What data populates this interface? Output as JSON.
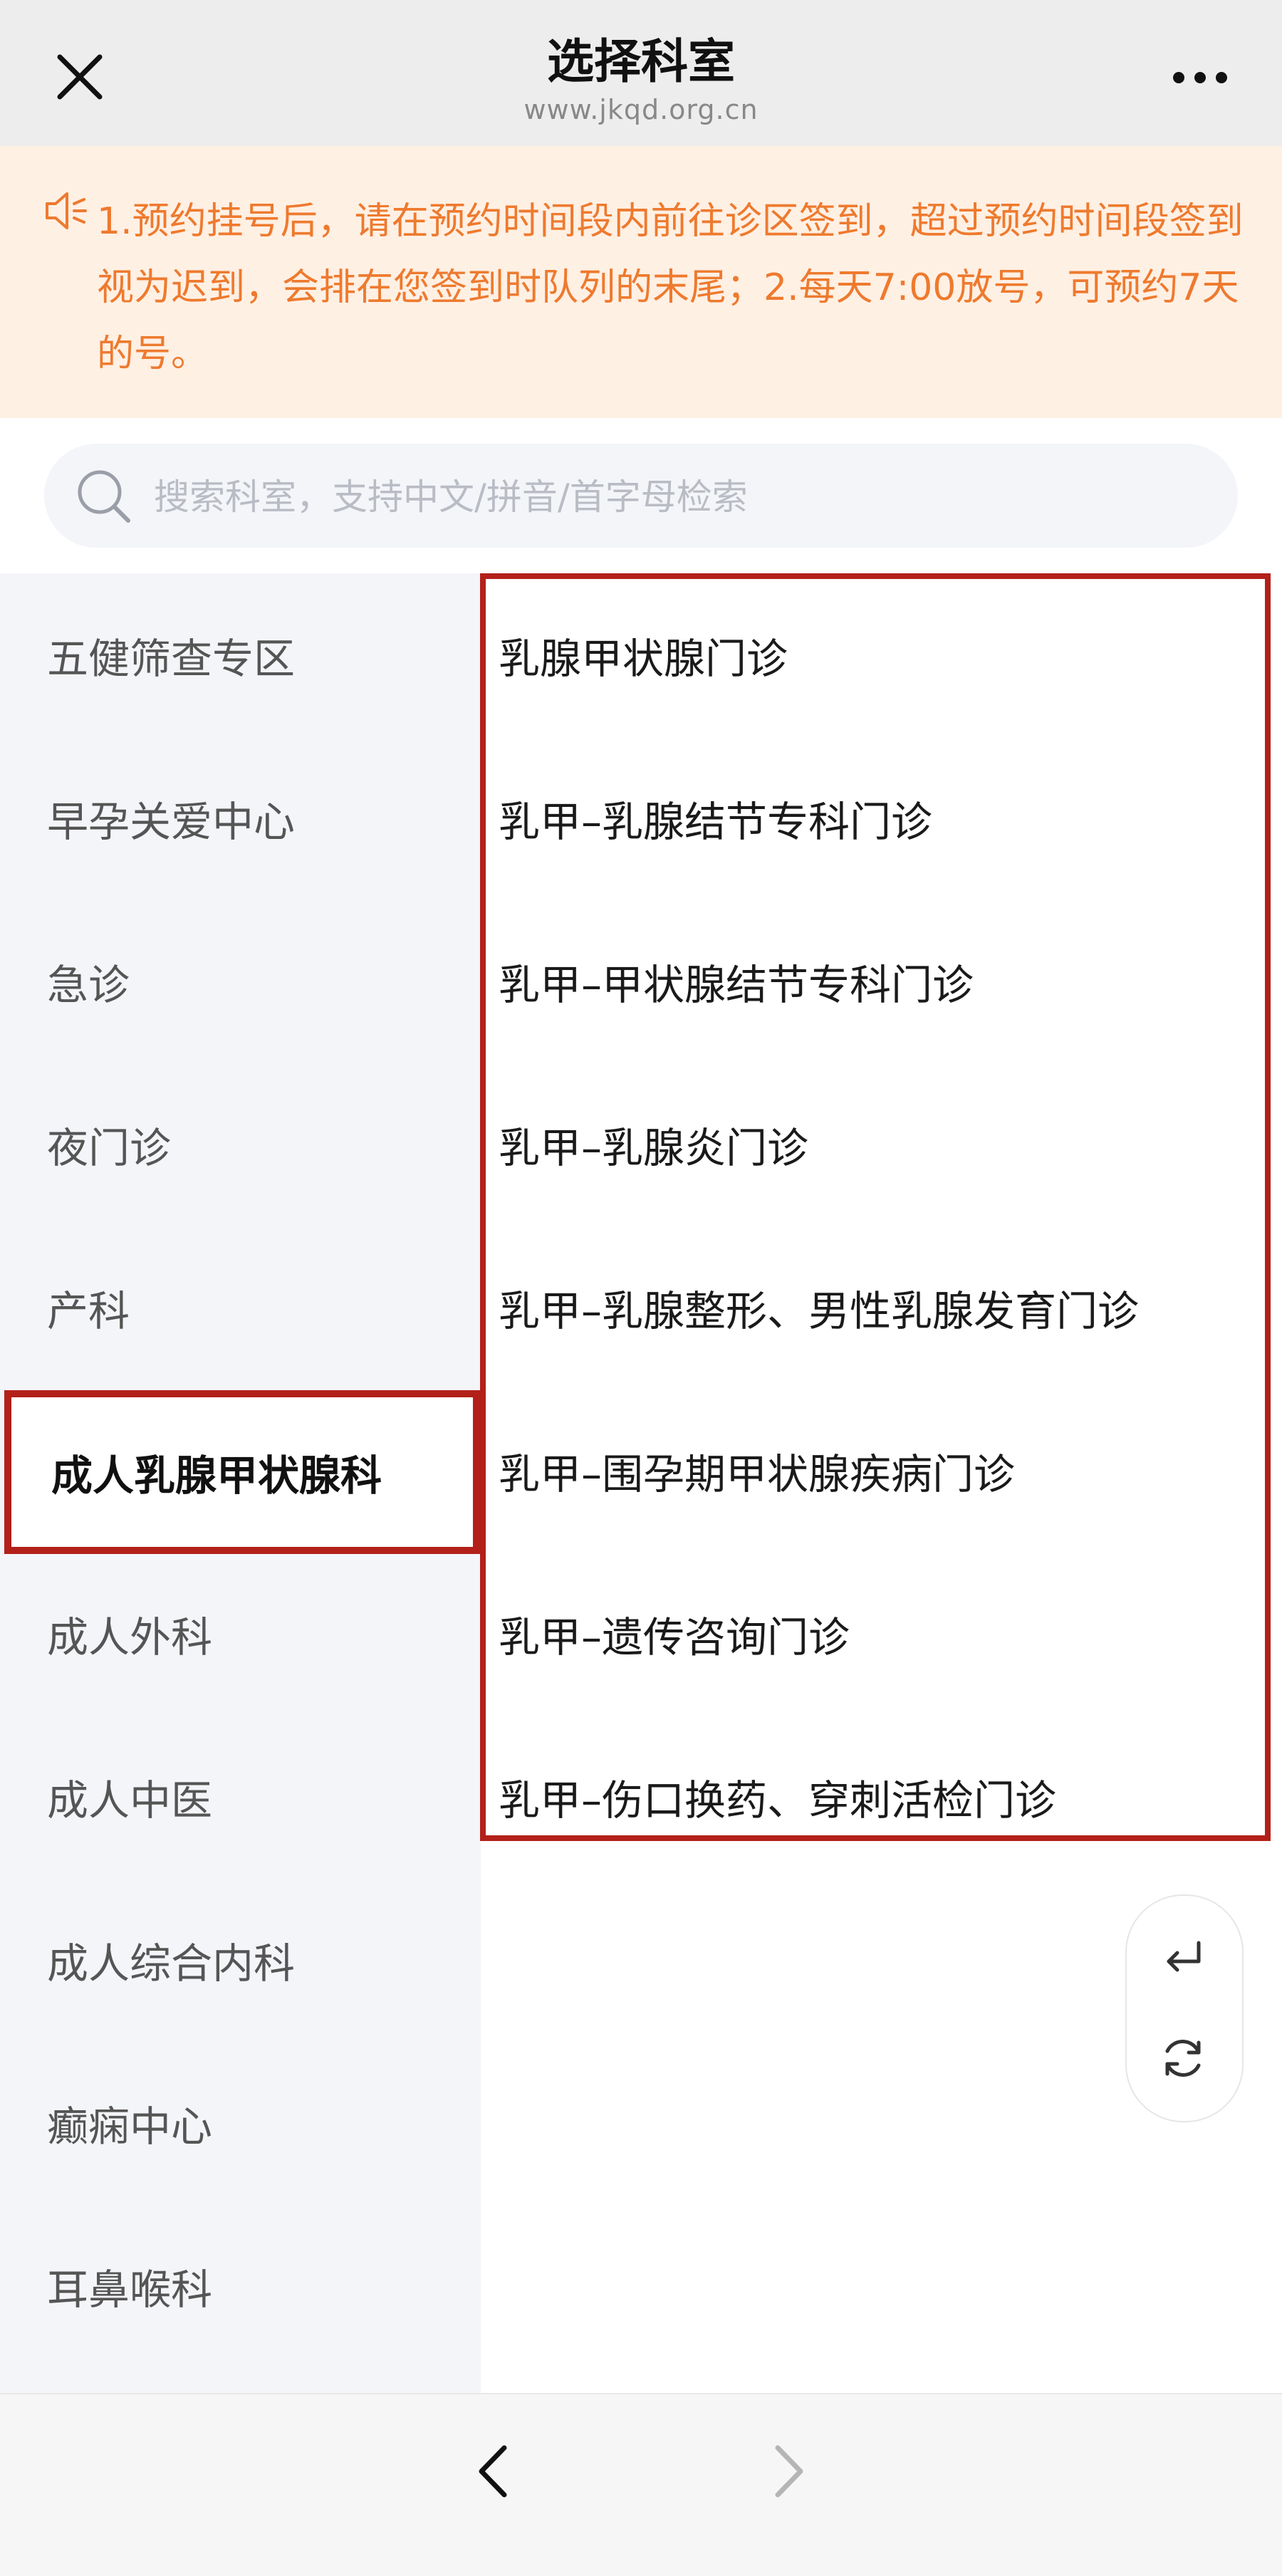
{
  "header": {
    "title": "选择科室",
    "subtitle": "www.jkqd.org.cn"
  },
  "notice": {
    "text": "1.预约挂号后，请在预约时间段内前往诊区签到，超过预约时间段签到视为迟到，会排在您签到时队列的末尾；2.每天7:00放号，可预约7天的号。"
  },
  "search": {
    "placeholder": "搜索科室，支持中文/拼音/首字母检索",
    "value": ""
  },
  "categories": [
    {
      "label": "五健筛查专区"
    },
    {
      "label": "早孕关爱中心"
    },
    {
      "label": "急诊"
    },
    {
      "label": "夜门诊"
    },
    {
      "label": "产科"
    },
    {
      "label": "成人乳腺甲状腺科",
      "active": true
    },
    {
      "label": "成人外科"
    },
    {
      "label": "成人中医"
    },
    {
      "label": "成人综合内科"
    },
    {
      "label": "癫痫中心"
    },
    {
      "label": "耳鼻喉科"
    }
  ],
  "departments": [
    {
      "label": "乳腺甲状腺门诊"
    },
    {
      "label": "乳甲–乳腺结节专科门诊"
    },
    {
      "label": "乳甲–甲状腺结节专科门诊"
    },
    {
      "label": "乳甲–乳腺炎门诊"
    },
    {
      "label": "乳甲–乳腺整形、男性乳腺发育门诊"
    },
    {
      "label": "乳甲–围孕期甲状腺疾病门诊"
    },
    {
      "label": "乳甲–遗传咨询门诊"
    },
    {
      "label": "乳甲–伤口换药、穿刺活检门诊"
    }
  ],
  "colors": {
    "accent_border": "#b3201a",
    "notice_text": "#ee7a2e",
    "notice_bg": "#fff0e4",
    "sidebar_bg": "#f4f5f9"
  },
  "icons": {
    "close": "close-icon",
    "more": "more-dots-icon",
    "speaker": "speaker-icon",
    "search": "search-icon",
    "return": "return-icon",
    "refresh": "refresh-icon",
    "back": "chevron-left-icon",
    "forward": "chevron-right-icon"
  }
}
